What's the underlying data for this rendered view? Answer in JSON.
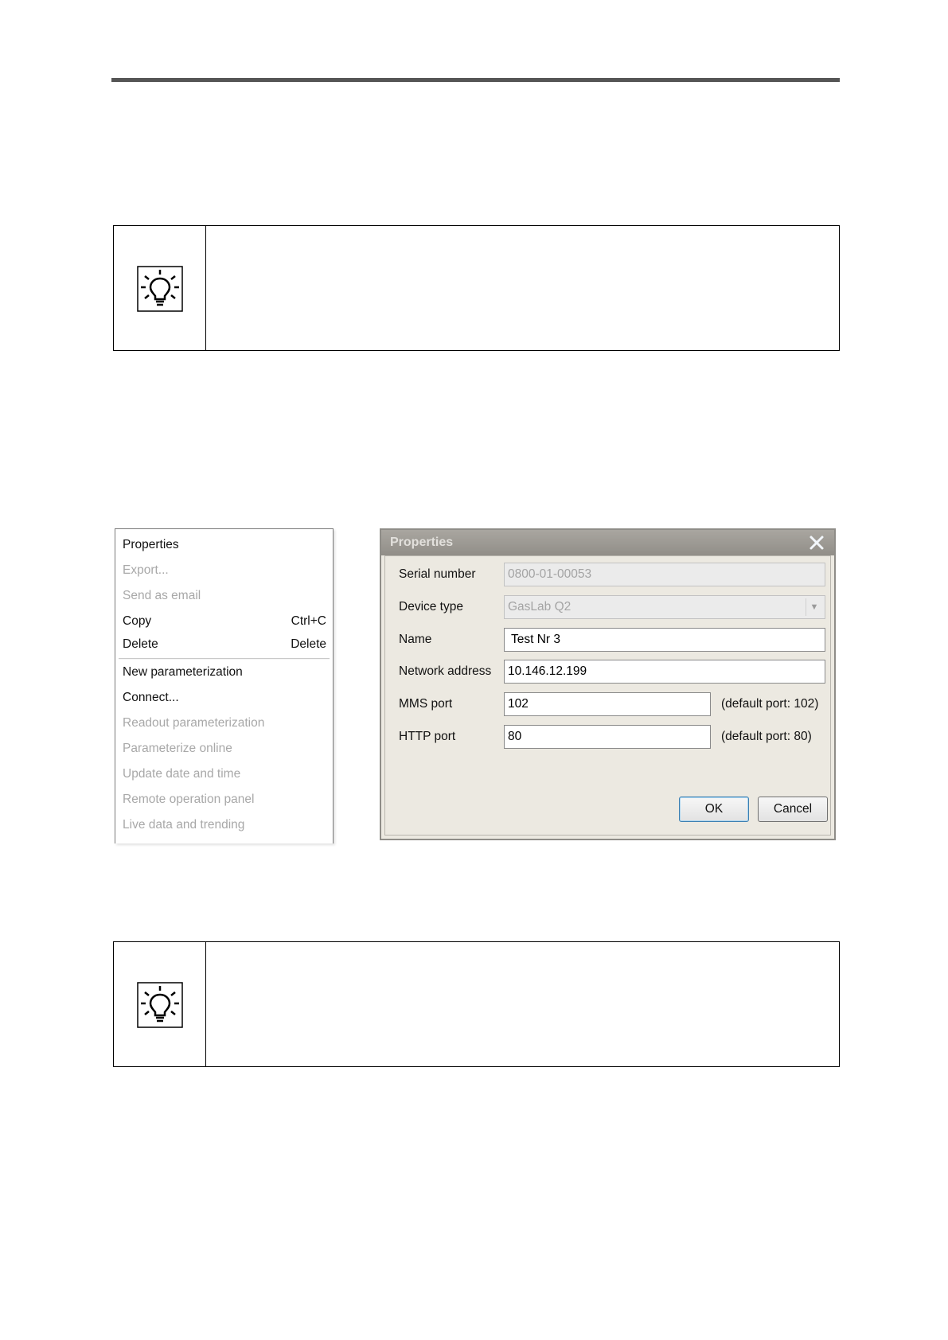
{
  "context_menu": {
    "items": [
      {
        "label": "Properties",
        "shortcut": "",
        "enabled": true
      },
      {
        "label": "Export...",
        "shortcut": "",
        "enabled": false
      },
      {
        "label": "Send as email",
        "shortcut": "",
        "enabled": false
      },
      {
        "label": "Copy",
        "shortcut": "Ctrl+C",
        "enabled": true
      },
      {
        "label": "Delete",
        "shortcut": "Delete",
        "enabled": true
      },
      {
        "label": "New parameterization",
        "shortcut": "",
        "enabled": true
      },
      {
        "label": "Connect...",
        "shortcut": "",
        "enabled": true
      },
      {
        "label": "Readout parameterization",
        "shortcut": "",
        "enabled": false
      },
      {
        "label": "Parameterize online",
        "shortcut": "",
        "enabled": false
      },
      {
        "label": "Update date and time",
        "shortcut": "",
        "enabled": false
      },
      {
        "label": "Remote operation panel",
        "shortcut": "",
        "enabled": false
      },
      {
        "label": "Live data and trending",
        "shortcut": "",
        "enabled": false
      }
    ]
  },
  "dialog": {
    "title": "Properties",
    "fields": {
      "serial_number": {
        "label": "Serial number",
        "value": "0800-01-00053"
      },
      "device_type": {
        "label": "Device type",
        "value": "GasLab Q2"
      },
      "name": {
        "label": "Name",
        "value": "Test Nr 3"
      },
      "network_address": {
        "label": "Network address",
        "value": "10.146.12.199"
      },
      "mms_port": {
        "label": "MMS port",
        "value": "102",
        "hint": "(default port: 102)"
      },
      "http_port": {
        "label": "HTTP port",
        "value": "80",
        "hint": "(default port: 80)"
      }
    },
    "ok_label": "OK",
    "cancel_label": "Cancel"
  },
  "colors": {
    "header_rule": "#555555",
    "menu_disabled_text": "#a8a8a8",
    "dialog_background": "#ece9e1",
    "default_button_border": "#3c7fb1"
  }
}
